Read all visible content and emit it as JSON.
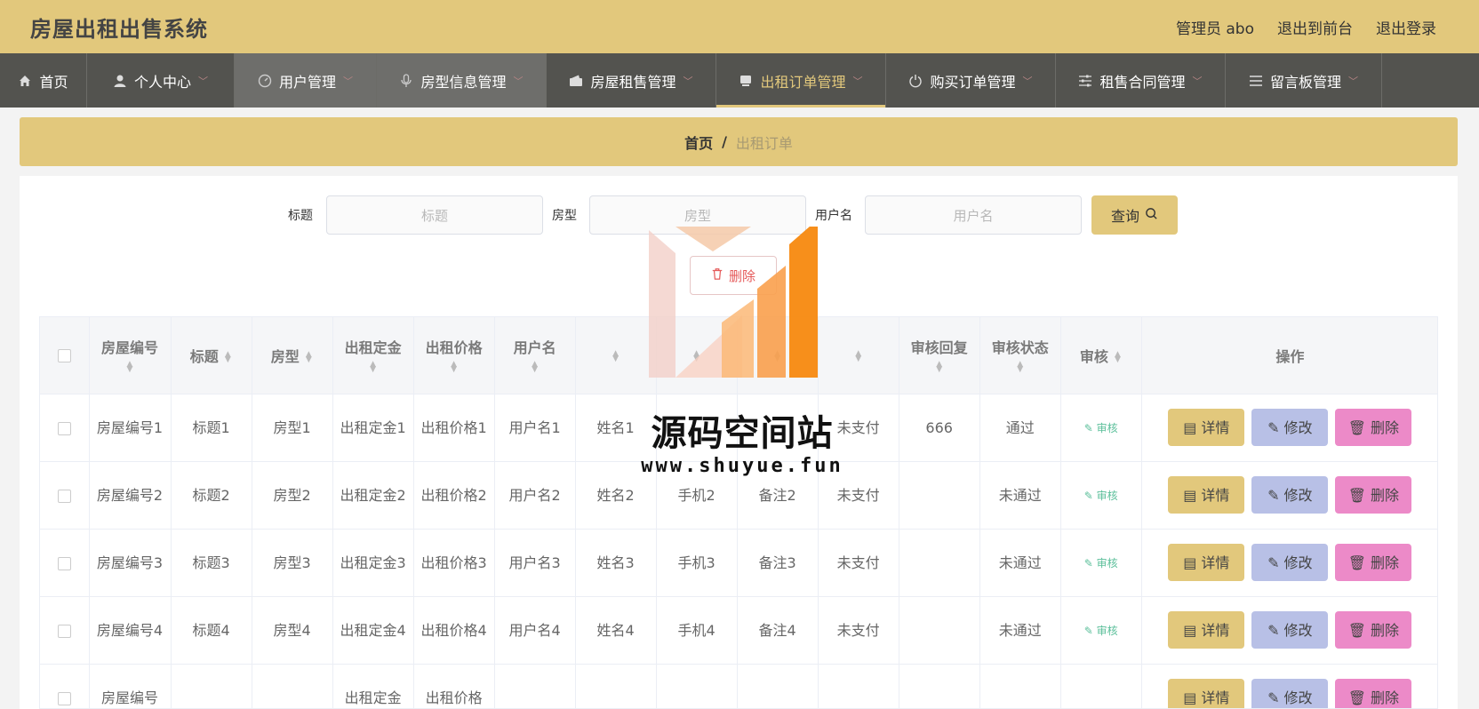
{
  "app": {
    "title": "房屋出租出售系统",
    "top_links": [
      "管理员 abo",
      "退出到前台",
      "退出登录"
    ]
  },
  "nav": [
    {
      "label": "首页",
      "icon": "home-icon"
    },
    {
      "label": "个人中心",
      "icon": "user-icon"
    },
    {
      "label": "用户管理",
      "icon": "gauge-icon"
    },
    {
      "label": "房型信息管理",
      "icon": "microphone-icon"
    },
    {
      "label": "房屋租售管理",
      "icon": "wallet-icon"
    },
    {
      "label": "出租订单管理",
      "icon": "cup-icon"
    },
    {
      "label": "购买订单管理",
      "icon": "power-icon"
    },
    {
      "label": "租售合同管理",
      "icon": "sliders-icon"
    },
    {
      "label": "留言板管理",
      "icon": "list-icon"
    }
  ],
  "breadcrumb": {
    "home": "首页",
    "separator": "/",
    "current": "出租订单"
  },
  "search": {
    "title_label": "标题",
    "title_placeholder": "标题",
    "type_label": "房型",
    "type_placeholder": "房型",
    "user_label": "用户名",
    "user_placeholder": "用户名",
    "query_label": "查询"
  },
  "toolbar": {
    "delete_label": "删除"
  },
  "table": {
    "columns": [
      "房屋编号",
      "标题",
      "房型",
      "出租定金",
      "出租价格",
      "用户名",
      "",
      "",
      "",
      "",
      "审核回复",
      "审核状态",
      "审核",
      "操作"
    ],
    "rows": [
      {
        "no": "房屋编号1",
        "title": "标题1",
        "type": "房型1",
        "deposit": "出租定金1",
        "price": "出租价格1",
        "user": "用户名1",
        "name": "姓名1",
        "phone": "",
        "note": "",
        "pay": "未支付",
        "reply": "666",
        "status": "通过"
      },
      {
        "no": "房屋编号2",
        "title": "标题2",
        "type": "房型2",
        "deposit": "出租定金2",
        "price": "出租价格2",
        "user": "用户名2",
        "name": "姓名2",
        "phone": "手机2",
        "note": "备注2",
        "pay": "未支付",
        "reply": "",
        "status": "未通过"
      },
      {
        "no": "房屋编号3",
        "title": "标题3",
        "type": "房型3",
        "deposit": "出租定金3",
        "price": "出租价格3",
        "user": "用户名3",
        "name": "姓名3",
        "phone": "手机3",
        "note": "备注3",
        "pay": "未支付",
        "reply": "",
        "status": "未通过"
      },
      {
        "no": "房屋编号4",
        "title": "标题4",
        "type": "房型4",
        "deposit": "出租定金4",
        "price": "出租价格4",
        "user": "用户名4",
        "name": "姓名4",
        "phone": "手机4",
        "note": "备注4",
        "pay": "未支付",
        "reply": "",
        "status": "未通过"
      },
      {
        "no": "房屋编号",
        "title": "",
        "type": "",
        "deposit": "出租定金",
        "price": "出租价格",
        "user": "",
        "name": "",
        "phone": "",
        "note": "",
        "pay": "",
        "reply": "",
        "status": ""
      }
    ],
    "audit_label": "审核",
    "btn_detail": "详情",
    "btn_edit": "修改",
    "btn_delete": "删除"
  },
  "watermark": {
    "title": "源码空间站",
    "url": "www.shuyue.fun"
  },
  "colors": {
    "accent": "#e2c87c",
    "nav_bg": "#53534f",
    "detail": "#e2c87c",
    "edit": "#b8c0e6",
    "delete": "#ec8ac8"
  }
}
